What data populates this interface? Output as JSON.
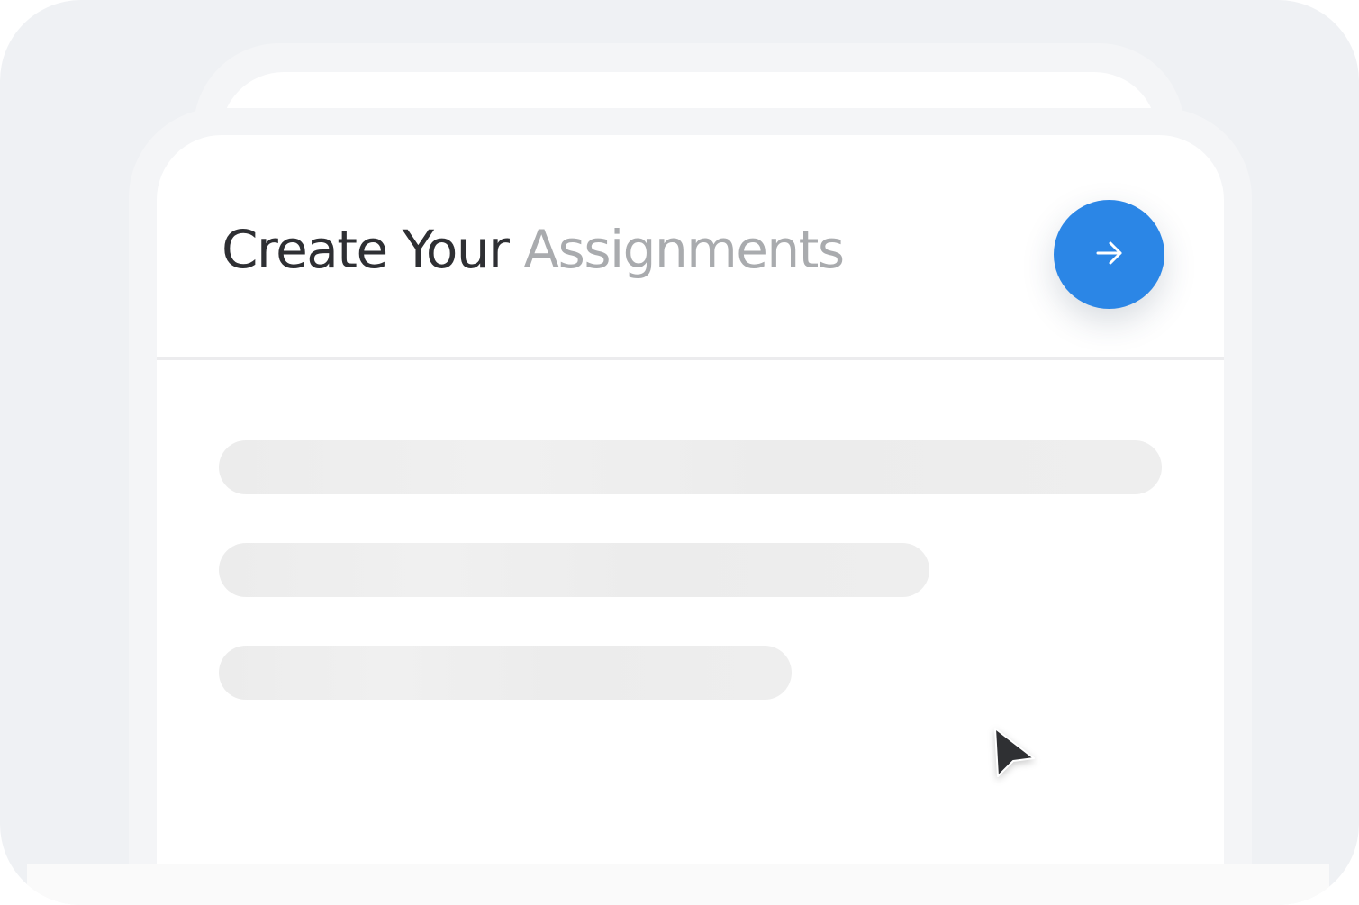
{
  "card": {
    "title_part_1": "Create Your",
    "title_part_2": "Assignments"
  },
  "colors": {
    "accent": "#2b86e6",
    "title_dark": "#2e2f33",
    "title_light": "#a9abae",
    "background": "#eff1f4"
  },
  "icons": {
    "next_button": "arrow-right-icon",
    "pointer": "mouse-cursor-icon"
  }
}
